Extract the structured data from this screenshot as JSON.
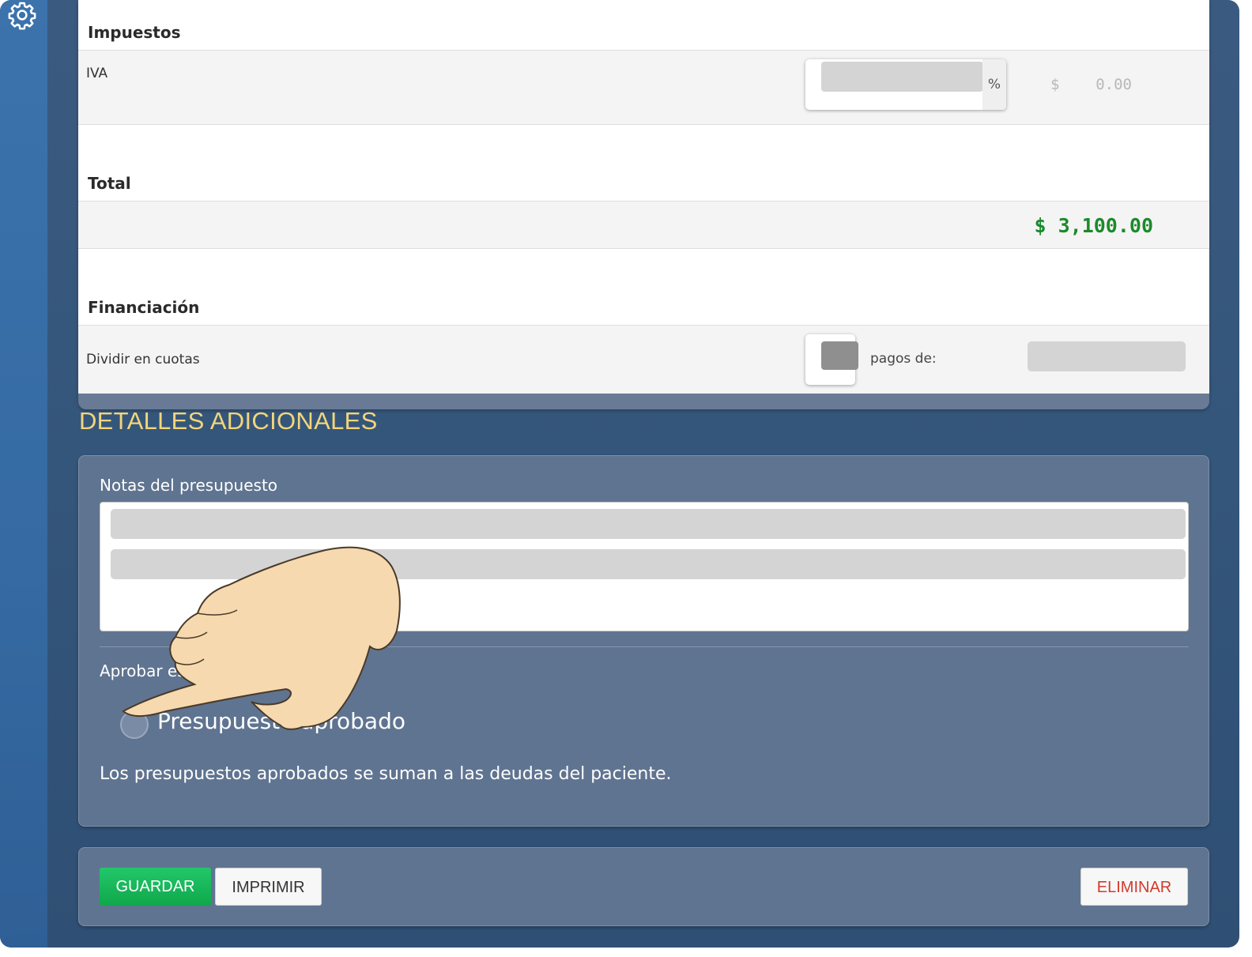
{
  "sidebar": {
    "icon": "gear-icon"
  },
  "taxes": {
    "heading": "Impuestos",
    "iva_label": "IVA",
    "percent_symbol": "%",
    "amount": "$    0.00"
  },
  "total": {
    "heading": "Total",
    "amount": "$ 3,100.00",
    "color": "#1a8a2a"
  },
  "financing": {
    "heading": "Financiación",
    "split_label": "Dividir en cuotas",
    "payments_label": "pagos de:"
  },
  "details": {
    "title": "DETALLES ADICIONALES",
    "notes_label": "Notas del presupuesto",
    "approve_label": "Aprobar este presupuesto",
    "approved_radio_label": "Presupuesto aprobado",
    "approved_note": "Los presupuestos aprobados se suman a las deudas del paciente."
  },
  "actions": {
    "save": "GUARDAR",
    "print": "IMPRIMIR",
    "delete": "ELIMINAR"
  },
  "colors": {
    "title_yellow": "#f3d57a",
    "save_green": "#10a84b",
    "delete_red": "#d33a2c"
  }
}
